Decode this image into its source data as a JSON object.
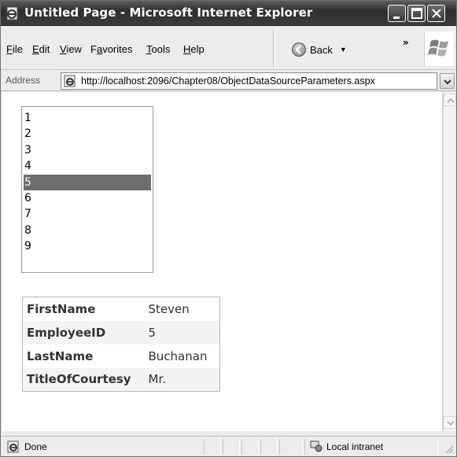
{
  "window": {
    "title": "Untitled Page - Microsoft Internet Explorer"
  },
  "menu": {
    "items": [
      {
        "label": "File",
        "mnemonic": "F"
      },
      {
        "label": "Edit",
        "mnemonic": "E"
      },
      {
        "label": "View",
        "mnemonic": "V"
      },
      {
        "label": "Favorites",
        "mnemonic": "a"
      },
      {
        "label": "Tools",
        "mnemonic": "T"
      },
      {
        "label": "Help",
        "mnemonic": "H"
      }
    ],
    "back_label": "Back",
    "more_label": "»"
  },
  "address": {
    "label": "Address",
    "url": "http://localhost:2096/Chapter08/ObjectDataSourceParameters.aspx"
  },
  "listbox": {
    "items": [
      "1",
      "2",
      "3",
      "4",
      "5",
      "6",
      "7",
      "8",
      "9"
    ],
    "selected": "5"
  },
  "details": {
    "rows": [
      {
        "field": "FirstName",
        "value": "Steven"
      },
      {
        "field": "EmployeeID",
        "value": "5"
      },
      {
        "field": "LastName",
        "value": "Buchanan"
      },
      {
        "field": "TitleOfCourtesy",
        "value": "Mr."
      }
    ]
  },
  "status": {
    "text": "Done",
    "zone": "Local intranet"
  },
  "colors": {
    "title_bar": "#3c3c3c",
    "selected_item": "#6e6e6e"
  }
}
